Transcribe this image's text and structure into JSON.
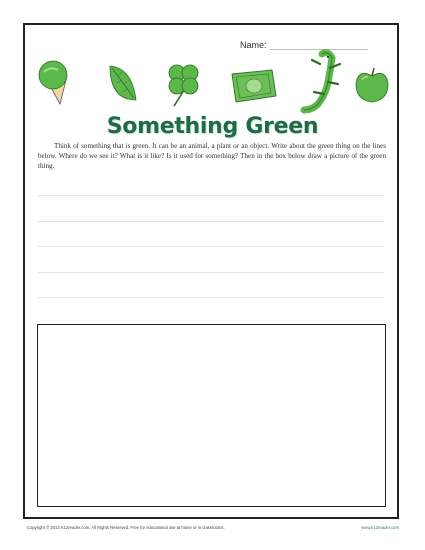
{
  "header": {
    "name_label": "Name:"
  },
  "icons": [
    "ice-cream-icon",
    "leaf-icon",
    "clover-icon",
    "dollar-bill-icon",
    "lizard-icon",
    "apple-icon"
  ],
  "title": "Something Green",
  "instructions": "Think of something that is green. It can be an animal, a plant or an object. Write about the green thing on the lines below. Where do we see it? What is it like? Is it used for something? Then in the box below draw a picture of the green thing.",
  "writing_lines": 5,
  "footer": {
    "copyright": "Copyright © 2013 K12reader.com. All Rights Reserved. Free for educational use at home or in classrooms.",
    "url": "www.k12reader.com"
  },
  "colors": {
    "accent": "#1e6b45",
    "icon_green": "#5cb84a",
    "icon_dark": "#2f7a2c"
  }
}
